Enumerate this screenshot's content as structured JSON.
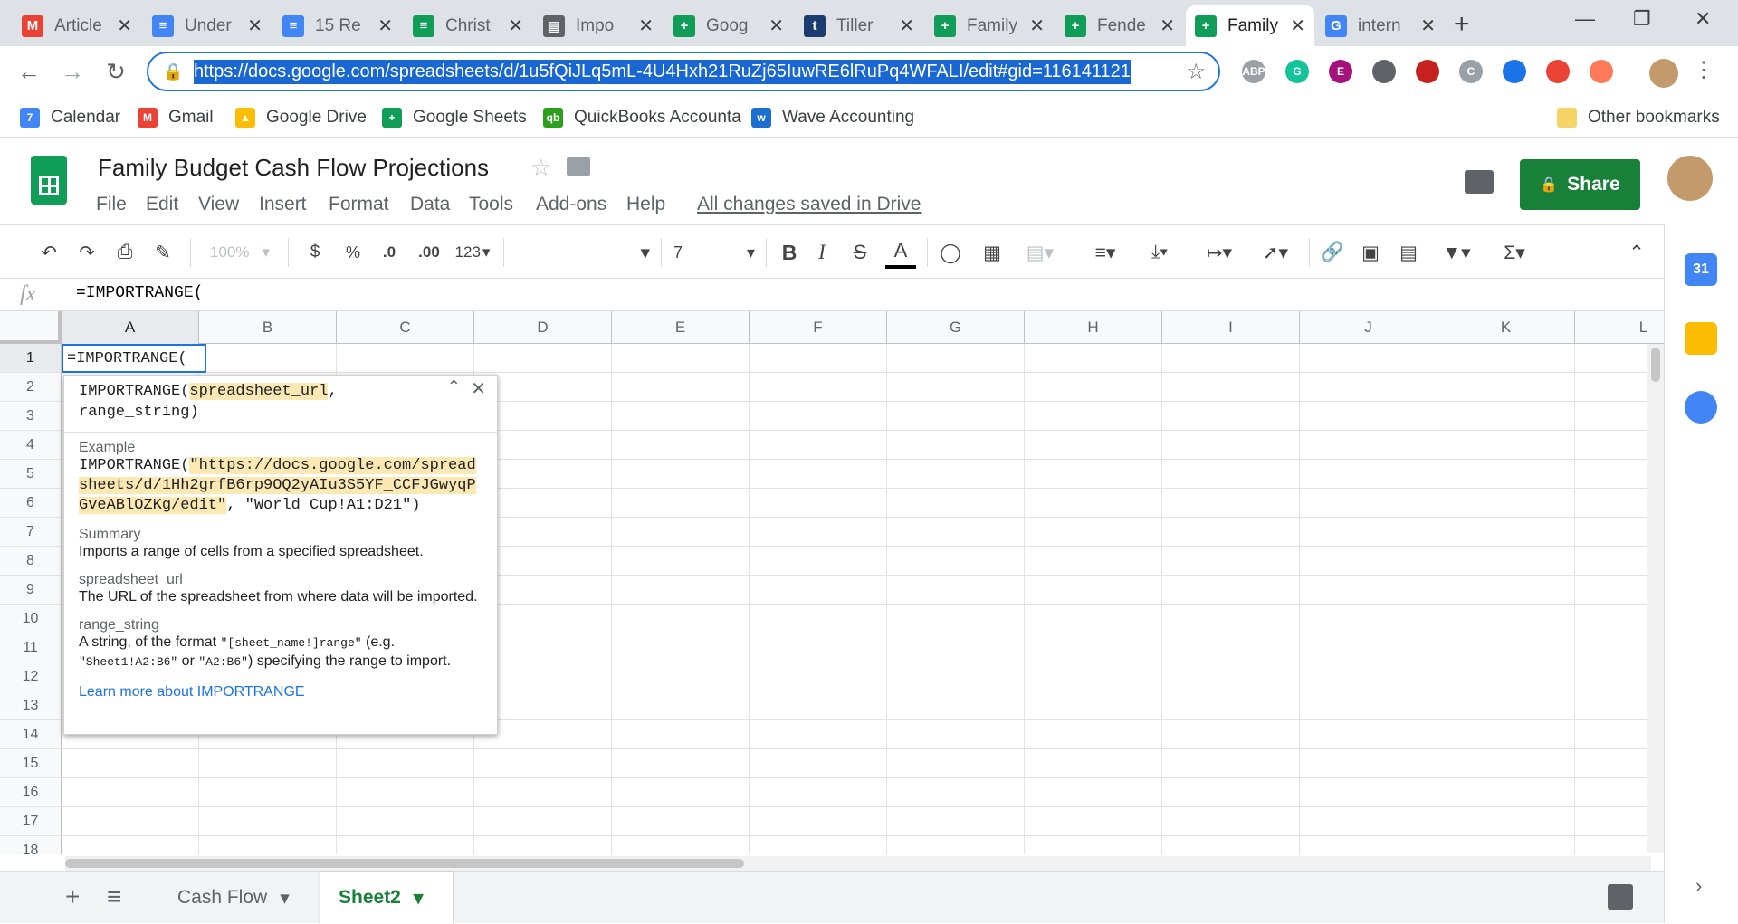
{
  "browser": {
    "tabs": [
      {
        "title": "Article",
        "icon": "gmail-icon"
      },
      {
        "title": "Under",
        "icon": "docs-icon"
      },
      {
        "title": "15 Re",
        "icon": "docs-icon"
      },
      {
        "title": "Christ",
        "icon": "db-icon"
      },
      {
        "title": "Impo",
        "icon": "book-icon"
      },
      {
        "title": "Goog",
        "icon": "sheets-icon"
      },
      {
        "title": "Tiller",
        "icon": "tiller-icon"
      },
      {
        "title": "Family",
        "icon": "sheets-icon"
      },
      {
        "title": "Fende",
        "icon": "sheets-icon"
      },
      {
        "title": "Family",
        "icon": "sheets-icon",
        "active": true
      },
      {
        "title": "intern",
        "icon": "google-icon"
      }
    ],
    "new_tab_symbol": "+",
    "url": "https://docs.google.com/spreadsheets/d/1u5fQiJLq5mL-4U4Hxh21RuZj65IuwRE6lRuPq4WFALI/edit#gid=116141121",
    "extensions": [
      "ABP",
      "G",
      "E",
      "",
      "",
      "C",
      "",
      "",
      ""
    ],
    "bookmarks": [
      {
        "label": "Calendar",
        "icon": "calendar-icon"
      },
      {
        "label": "Gmail",
        "icon": "gmail-icon"
      },
      {
        "label": "Google Drive",
        "icon": "drive-icon"
      },
      {
        "label": "Google Sheets",
        "icon": "sheets-icon"
      },
      {
        "label": "QuickBooks Accounta",
        "icon": "quickbooks-icon"
      },
      {
        "label": "Wave Accounting",
        "icon": "wave-icon"
      }
    ],
    "other_bookmarks": "Other bookmarks"
  },
  "doc": {
    "title": "Family Budget Cash Flow Projections",
    "menus": [
      "File",
      "Edit",
      "View",
      "Insert",
      "Format",
      "Data",
      "Tools",
      "Add-ons",
      "Help"
    ],
    "saved_status": "All changes saved in Drive",
    "share_label": "Share"
  },
  "toolbar": {
    "zoom": "100%",
    "currency": "$",
    "percent": "%",
    "dec_decrease": ".0",
    "dec_increase": ".00",
    "more_formats": "123",
    "font_size": "7"
  },
  "formula_bar": {
    "fx_label": "fx",
    "value": "=IMPORTRANGE("
  },
  "grid": {
    "columns": [
      "A",
      "B",
      "C",
      "D",
      "E",
      "F",
      "G",
      "H",
      "I",
      "J",
      "K",
      "L"
    ],
    "rows": [
      "1",
      "2",
      "3",
      "4",
      "5",
      "6",
      "7",
      "8",
      "9",
      "10",
      "11",
      "12",
      "13",
      "14",
      "15",
      "16",
      "17",
      "18"
    ],
    "active_cell_value": "=IMPORTRANGE("
  },
  "help_popup": {
    "sig_fn": "IMPORTRANGE(",
    "sig_arg1": "spreadsheet_url",
    "sig_rest": ",",
    "sig_line2": "range_string)",
    "example_label": "Example",
    "example_fn": "IMPORTRANGE(",
    "example_url": "\"https://docs.google.com/spreadsheets/d/1Hh2grfB6rp9OQ2yAIu3S5YF_CCFJGwyqPGveABlOZKg/edit\"",
    "example_rest": ", \"World Cup!A1:D21\")",
    "summary_label": "Summary",
    "summary_text": "Imports a range of cells from a specified spreadsheet.",
    "param1_name": "spreadsheet_url",
    "param1_desc": "The URL of the spreadsheet from where data will be imported.",
    "param2_name": "range_string",
    "param2_desc_a": "A string, of the format ",
    "param2_code_a": "\"[sheet_name!]range\"",
    "param2_desc_b": " (e.g. ",
    "param2_code_b": "\"Sheet1!A2:B6\"",
    "param2_desc_c": " or ",
    "param2_code_c": "\"A2:B6\"",
    "param2_desc_d": ") specifying the range to import.",
    "learn_more": "Learn more about IMPORTRANGE"
  },
  "sheet_tabs": {
    "add": "+",
    "list": "≡",
    "tabs": [
      {
        "label": "Cash Flow",
        "active": false
      },
      {
        "label": "Sheet2",
        "active": true
      }
    ]
  },
  "side_panel": {
    "calendar_day": "31"
  }
}
